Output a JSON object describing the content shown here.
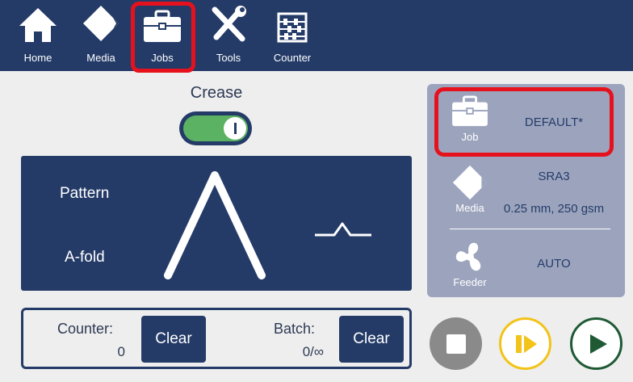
{
  "nav": {
    "items": [
      {
        "label": "Home",
        "icon": "home-icon"
      },
      {
        "label": "Media",
        "icon": "media-icon"
      },
      {
        "label": "Jobs",
        "icon": "briefcase-icon"
      },
      {
        "label": "Tools",
        "icon": "tools-icon"
      },
      {
        "label": "Counter",
        "icon": "abacus-icon"
      }
    ],
    "active": "Jobs"
  },
  "crease": {
    "label": "Crease",
    "enabled": true
  },
  "pattern": {
    "label": "Pattern",
    "value": "A-fold"
  },
  "counter": {
    "label": "Counter:",
    "value": "0",
    "clear_label": "Clear"
  },
  "batch": {
    "label": "Batch:",
    "value": "0/∞",
    "clear_label": "Clear"
  },
  "status": {
    "job": {
      "label": "Job",
      "value": "DEFAULT*"
    },
    "media": {
      "label": "Media",
      "name": "SRA3",
      "spec": "0.25 mm, 250 gsm"
    },
    "feeder": {
      "label": "Feeder",
      "value": "AUTO"
    }
  },
  "controls": {
    "stop": "stop-icon",
    "step": "step-play-icon",
    "play": "play-icon"
  },
  "colors": {
    "navy": "#243b68",
    "highlight": "#e5121d",
    "toggle_on": "#5bb262",
    "panel_grey": "#9ca4bd",
    "step_yellow": "#f2c318",
    "play_green": "#1f5a35"
  }
}
